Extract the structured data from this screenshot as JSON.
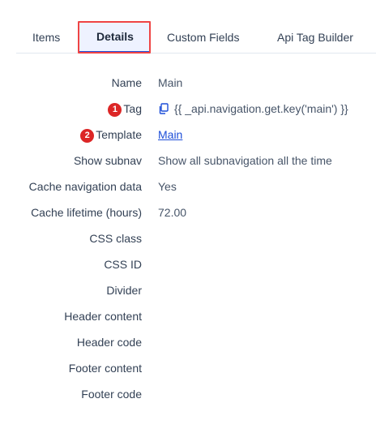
{
  "tabs": [
    {
      "label": "Items"
    },
    {
      "label": "Details"
    },
    {
      "label": "Custom Fields"
    },
    {
      "label": "Api Tag Builder"
    }
  ],
  "active_tab": "Details",
  "details": [
    {
      "label": "Name",
      "value": "Main"
    },
    {
      "label": "Tag",
      "value": "{{ _api.navigation.get.key('main') }}",
      "marker": "1",
      "icon": "copy-icon"
    },
    {
      "label": "Template",
      "value": "Main",
      "marker": "2",
      "link": true
    },
    {
      "label": "Show subnav",
      "value": "Show all subnavigation all the time"
    },
    {
      "label": "Cache navigation data",
      "value": "Yes"
    },
    {
      "label": "Cache lifetime (hours)",
      "value": "72.00"
    },
    {
      "label": "CSS class",
      "value": ""
    },
    {
      "label": "CSS ID",
      "value": ""
    },
    {
      "label": "Divider",
      "value": ""
    },
    {
      "label": "Header content",
      "value": ""
    },
    {
      "label": "Header code",
      "value": ""
    },
    {
      "label": "Footer content",
      "value": ""
    },
    {
      "label": "Footer code",
      "value": ""
    }
  ],
  "colors": {
    "accent": "#1d4ed8",
    "marker": "#dc2626",
    "highlight": "#ef4444",
    "active_tab_bg": "#eef2ff"
  }
}
